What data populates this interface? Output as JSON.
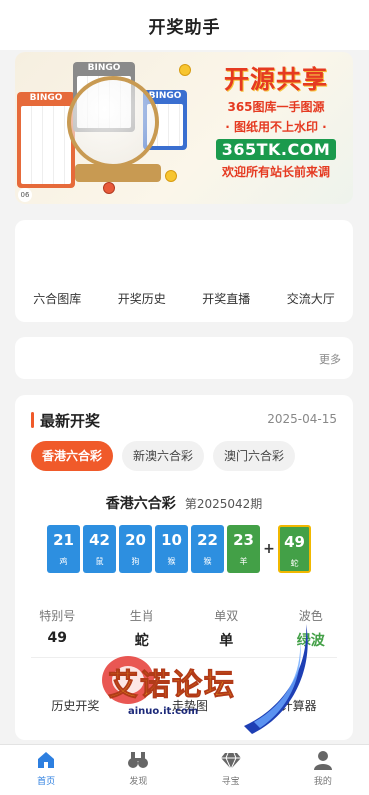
{
  "header": {
    "title": "开奖助手"
  },
  "banner": {
    "bingo_label": "BINGO",
    "title": "开源共享",
    "line1": "365图库一手图源",
    "line2": "· 图纸用不上水印 ·",
    "site": "365TK.COM",
    "welcome": "欢迎所有站长前来调",
    "corner_tag": "06"
  },
  "menu": {
    "items": [
      "六合图库",
      "开奖历史",
      "开奖直播",
      "交流大厅"
    ]
  },
  "notice": {
    "more_label": "更多"
  },
  "draw": {
    "section_title": "最新开奖",
    "date": "2025-04-15",
    "tabs": [
      "香港六合彩",
      "新澳六合彩",
      "澳门六合彩"
    ],
    "active_tab": 0,
    "lottery_name": "香港六合彩",
    "period": "第2025042期",
    "balls": [
      {
        "num": "21",
        "zodiac": "鸡",
        "color": "blue"
      },
      {
        "num": "42",
        "zodiac": "鼠",
        "color": "blue"
      },
      {
        "num": "20",
        "zodiac": "狗",
        "color": "blue"
      },
      {
        "num": "10",
        "zodiac": "猴",
        "color": "blue"
      },
      {
        "num": "22",
        "zodiac": "猴",
        "color": "blue"
      },
      {
        "num": "23",
        "zodiac": "羊",
        "color": "green"
      }
    ],
    "plus": "+",
    "special_ball": {
      "num": "49",
      "zodiac": "蛇",
      "color": "green"
    },
    "stats": [
      {
        "label": "特别号",
        "value": "49",
        "color": "default"
      },
      {
        "label": "生肖",
        "value": "蛇",
        "color": "default"
      },
      {
        "label": "单双",
        "value": "单",
        "color": "default"
      },
      {
        "label": "波色",
        "value": "绿波",
        "color": "green"
      }
    ],
    "actions": [
      "历史开奖",
      "走势图",
      "计算器"
    ]
  },
  "watermark": {
    "text": "艾诺论坛",
    "url": "ainuo.it.com"
  },
  "tabbar": {
    "items": [
      {
        "label": "首页",
        "icon": "home-icon",
        "active": true
      },
      {
        "label": "发现",
        "icon": "binoculars-icon",
        "active": false
      },
      {
        "label": "寻宝",
        "icon": "diamond-icon",
        "active": false
      },
      {
        "label": "我的",
        "icon": "user-icon",
        "active": false
      }
    ]
  },
  "colors": {
    "accent": "#f05a2a",
    "ball_blue": "#2d8fe0",
    "ball_green": "#43a047",
    "tab_active": "#2d7fe0"
  }
}
